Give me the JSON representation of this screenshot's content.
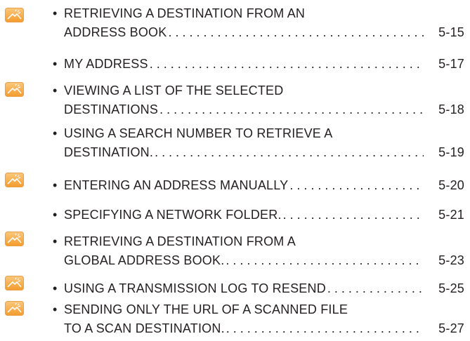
{
  "icon_name": "touch-panel-operation-icon",
  "bullet_char": "•",
  "entries": [
    {
      "lines": [
        "RETRIEVING A DESTINATION FROM AN",
        "ADDRESS BOOK"
      ],
      "page": "5-15",
      "has_icon": true
    },
    {
      "lines": [
        "MY ADDRESS"
      ],
      "page": "5-17",
      "has_icon": false
    },
    {
      "lines": [
        "VIEWING A LIST OF THE SELECTED",
        "DESTINATIONS"
      ],
      "page": "5-18",
      "has_icon": true
    },
    {
      "lines": [
        "USING A SEARCH NUMBER TO RETRIEVE A",
        "DESTINATION."
      ],
      "page": "5-19",
      "has_icon": false
    },
    {
      "lines": [
        "ENTERING AN ADDRESS MANUALLY"
      ],
      "page": "5-20",
      "has_icon": true
    },
    {
      "lines": [
        "SPECIFYING A NETWORK FOLDER."
      ],
      "page": "5-21",
      "has_icon": false
    },
    {
      "lines": [
        "RETRIEVING A DESTINATION FROM A",
        "GLOBAL ADDRESS BOOK."
      ],
      "page": "5-23",
      "has_icon": true
    },
    {
      "lines": [
        "USING A TRANSMISSION LOG TO RESEND"
      ],
      "page": "5-25",
      "has_icon": true
    },
    {
      "lines": [
        "SENDING ONLY THE URL OF A SCANNED FILE",
        "TO A SCAN DESTINATION."
      ],
      "page": "5-27",
      "has_icon": true
    }
  ]
}
